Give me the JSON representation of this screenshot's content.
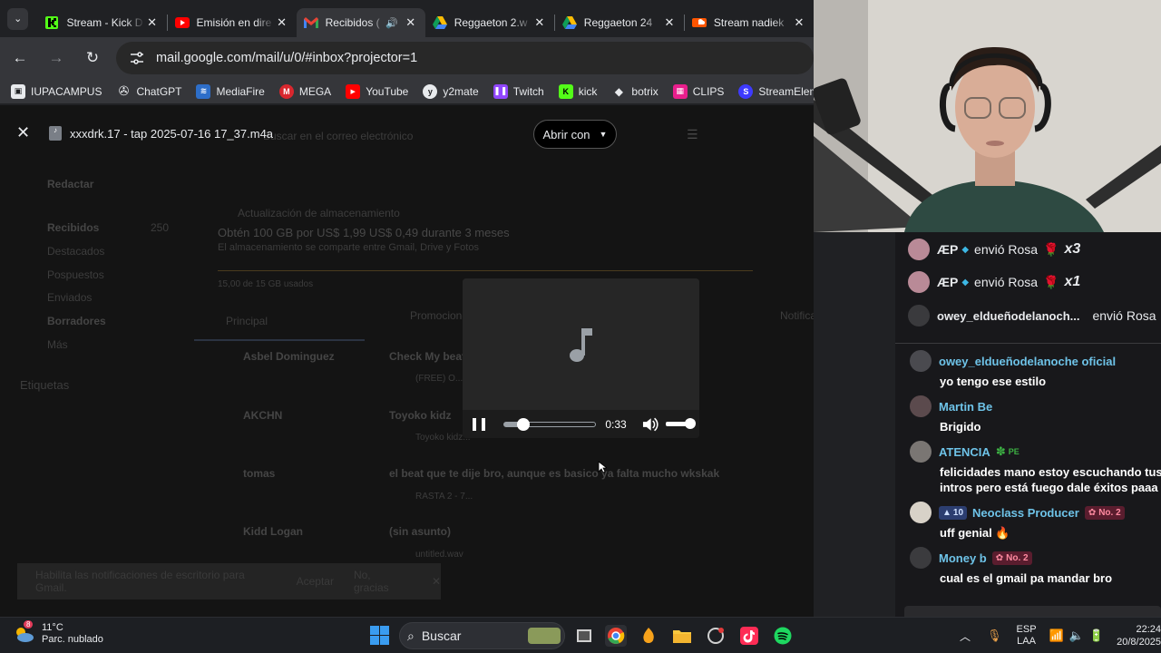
{
  "browser": {
    "tabs": [
      {
        "title": "Stream - Kick D",
        "icon": "kick-icon",
        "active": false
      },
      {
        "title": "Emisión en dire",
        "icon": "youtube-icon",
        "active": false
      },
      {
        "title": "Recibidos (",
        "icon": "gmail-icon",
        "active": true
      },
      {
        "title": "Reggaeton 2.w",
        "icon": "google-drive-icon",
        "active": false
      },
      {
        "title": "Reggaeton 24",
        "icon": "google-drive-icon",
        "active": false
      },
      {
        "title": "Stream nadiek",
        "icon": "soundcloud-icon",
        "active": false
      }
    ],
    "url": "mail.google.com/mail/u/0/#inbox?projector=1",
    "bookmarks": [
      {
        "label": "IUPACAMPUS",
        "icon": "folder-icon"
      },
      {
        "label": "ChatGPT",
        "icon": "chatgpt-icon"
      },
      {
        "label": "MediaFire",
        "icon": "mediafire-icon"
      },
      {
        "label": "MEGA",
        "icon": "mega-icon"
      },
      {
        "label": "YouTube",
        "icon": "youtube-icon"
      },
      {
        "label": "y2mate",
        "icon": "y2mate-icon"
      },
      {
        "label": "Twitch",
        "icon": "twitch-icon"
      },
      {
        "label": "kick",
        "icon": "kick-icon"
      },
      {
        "label": "botrix",
        "icon": "botrix-icon"
      },
      {
        "label": "CLIPS",
        "icon": "clips-icon"
      },
      {
        "label": "StreamElements",
        "icon": "streamelements-icon"
      }
    ]
  },
  "viewer": {
    "file_name": "xxxdrk.17 - tap 2025-07-16 17_37.m4a",
    "open_with": "Abrir con",
    "time": "0:33",
    "progress": 0.22,
    "volume": 1.0
  },
  "gmail_bg": {
    "search_placeholder": "Buscar en el correo electrónico",
    "compose": "Redactar",
    "folders": [
      "Recibidos",
      "Destacados",
      "Pospuestos",
      "Enviados",
      "Borradores",
      "Más"
    ],
    "inbox_count": "250",
    "labels_header": "Etiquetas",
    "storage_title": "Actualización de almacenamiento",
    "storage_offer": "Obtén 100 GB por US$ 1,99 US$ 0,49 durante 3 meses",
    "storage_sub": "El almacenamiento se comparte entre Gmail, Drive y Fotos",
    "storage_used": "15,00 de 15 GB usados",
    "tabs": [
      "Principal",
      "Promociones",
      "Notificaciones"
    ],
    "rows": [
      {
        "sender": "Asbel Dominguez",
        "subject": "Check My beat",
        "attachment": "(FREE) O..."
      },
      {
        "sender": "AKCHN",
        "subject": "Toyoko kidz",
        "attachment": "Toyoko kidz..."
      },
      {
        "sender": "tomas",
        "subject": "el beat que te dije bro, aunque es basico ya falta mucho wkskak",
        "attachment": "RASTA 2 - 7..."
      },
      {
        "sender": "Kidd Logan",
        "subject": "(sin asunto)",
        "attachment": "untitled.wav"
      }
    ],
    "snackbar": "Habilita las notificaciones de escritorio para Gmail.",
    "snackbar_accept": "Aceptar",
    "snackbar_no": "No, gracias"
  },
  "chat": {
    "gifts": [
      {
        "user": "ÆP",
        "action": "envió Rosa",
        "mult": "x3"
      },
      {
        "user": "ÆP",
        "action": "envió Rosa",
        "mult": "x1"
      },
      {
        "user": "owey_eldueñodelanoch...",
        "action": "envió Rosa",
        "mult": ""
      }
    ],
    "messages": [
      {
        "user": "owey_eldueñodelanoche oficial",
        "text": [
          "yo tengo ese estilo"
        ],
        "color": "#6ec3e8",
        "avatar": "#4a4a4f",
        "badges": []
      },
      {
        "user": "Martin Be",
        "text": [
          "Brigido"
        ],
        "color": "#6ec3e8",
        "avatar": "#5b4a4d",
        "badges": []
      },
      {
        "user": "ATENCIA",
        "text": [
          "felicidades mano estoy escuchando tus",
          "intros pero está fuego dale éxitos paaa"
        ],
        "color": "#6ec3e8",
        "avatar": "#7a7673",
        "badges": [
          "PE"
        ]
      },
      {
        "user": "Neoclass Producer",
        "text": [
          "uff genial 🔥"
        ],
        "color": "#6ec3e8",
        "avatar": "#d8d2c8",
        "badges": [
          "10",
          "No. 2"
        ]
      },
      {
        "user": "Money b",
        "text": [
          "cual es el gmail pa mandar bro"
        ],
        "color": "#6ec3e8",
        "avatar": "#3b3b3e",
        "badges": [
          "No. 2"
        ]
      }
    ]
  },
  "taskbar": {
    "weather_temp": "11°C",
    "weather_desc": "Parc. nublado",
    "weather_badge": "8",
    "search": "Buscar",
    "lang1": "ESP",
    "lang2": "LAA",
    "time": "22:24",
    "date": "20/8/2025"
  }
}
